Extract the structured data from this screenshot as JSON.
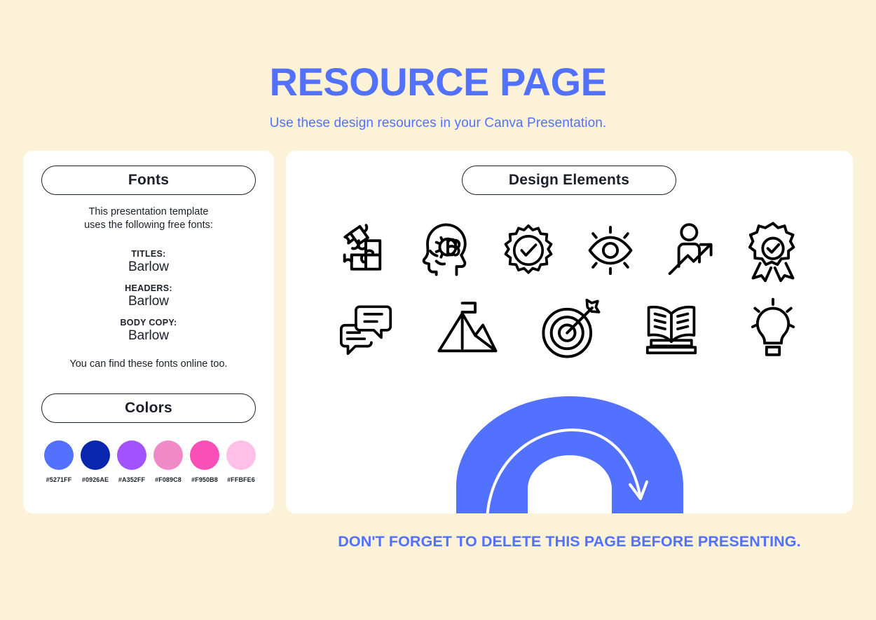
{
  "header": {
    "title": "RESOURCE PAGE",
    "subtitle": "Use these design resources in your Canva Presentation.",
    "title_color": "#5271FF"
  },
  "fonts_panel": {
    "heading": "Fonts",
    "intro_line1": "This presentation template",
    "intro_line2": "uses the following free fonts:",
    "rows": [
      {
        "role": "TITLES:",
        "font": "Barlow"
      },
      {
        "role": "HEADERS:",
        "font": "Barlow"
      },
      {
        "role": "BODY COPY:",
        "font": "Barlow"
      }
    ],
    "outro": "You can find these fonts online too."
  },
  "colors_panel": {
    "heading": "Colors",
    "swatches": [
      {
        "hex_label": "#5271FF",
        "hex": "#5271FF"
      },
      {
        "hex_label": "#0926AE",
        "hex": "#0926AE"
      },
      {
        "hex_label": "#A352FF",
        "hex": "#A352FF"
      },
      {
        "hex_label": "#F089C8",
        "hex": "#F089C8"
      },
      {
        "hex_label": "#F950B8",
        "hex": "#F950B8"
      },
      {
        "hex_label": "#FFBFE6",
        "hex": "#FFBFE6"
      }
    ]
  },
  "design_panel": {
    "heading": "Design Elements",
    "icons_row1": [
      "puzzle-pieces-icon",
      "head-brain-icon",
      "gear-check-icon",
      "eye-vision-icon",
      "person-growth-arrow-icon",
      "award-ribbon-check-icon"
    ],
    "icons_row2": [
      "speech-bubbles-icon",
      "mountain-flag-icon",
      "target-arrow-icon",
      "open-book-icon",
      "lightbulb-icon"
    ],
    "arch_graphic": {
      "name": "blue-arch-arrow-graphic",
      "fill_color": "#5271FF",
      "arrow_color": "#FFFFFF"
    }
  },
  "footer": {
    "warning": "DON'T FORGET TO DELETE THIS PAGE BEFORE PRESENTING.",
    "warning_color": "#5271FF"
  },
  "canvas": {
    "background_color": "#FCF2D8",
    "card_color": "#FFFFFF"
  }
}
